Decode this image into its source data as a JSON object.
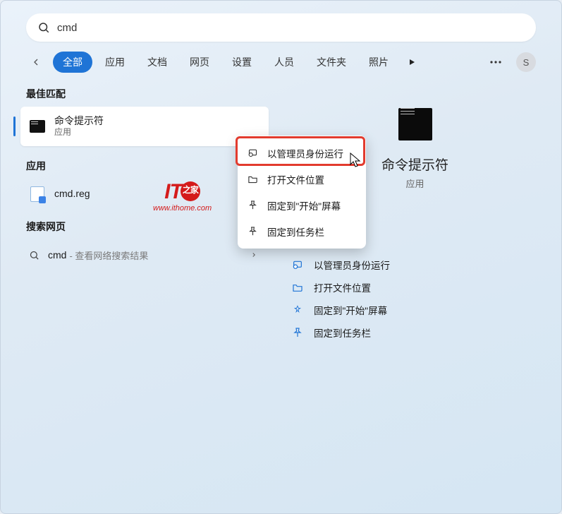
{
  "search": {
    "query": "cmd"
  },
  "tabs": {
    "all": "全部",
    "apps": "应用",
    "docs": "文档",
    "web": "网页",
    "settings": "设置",
    "people": "人员",
    "folders": "文件夹",
    "photos": "照片"
  },
  "avatar_letter": "S",
  "left": {
    "best_match_header": "最佳匹配",
    "best_match": {
      "title": "命令提示符",
      "sub": "应用"
    },
    "apps_header": "应用",
    "apps": [
      {
        "title": "cmd.reg"
      }
    ],
    "web_header": "搜索网页",
    "web": {
      "query": "cmd",
      "sub": "- 查看网络搜索结果"
    }
  },
  "context_menu": [
    "以管理员身份运行",
    "打开文件位置",
    "固定到\"开始\"屏幕",
    "固定到任务栏"
  ],
  "preview": {
    "title": "命令提示符",
    "sub": "应用",
    "actions": [
      "以管理员身份运行",
      "打开文件位置",
      "固定到\"开始\"屏幕",
      "固定到任务栏"
    ]
  },
  "watermark": {
    "line1_a": "IT",
    "url": "www.ithome.com",
    "circle_text": "之家"
  }
}
